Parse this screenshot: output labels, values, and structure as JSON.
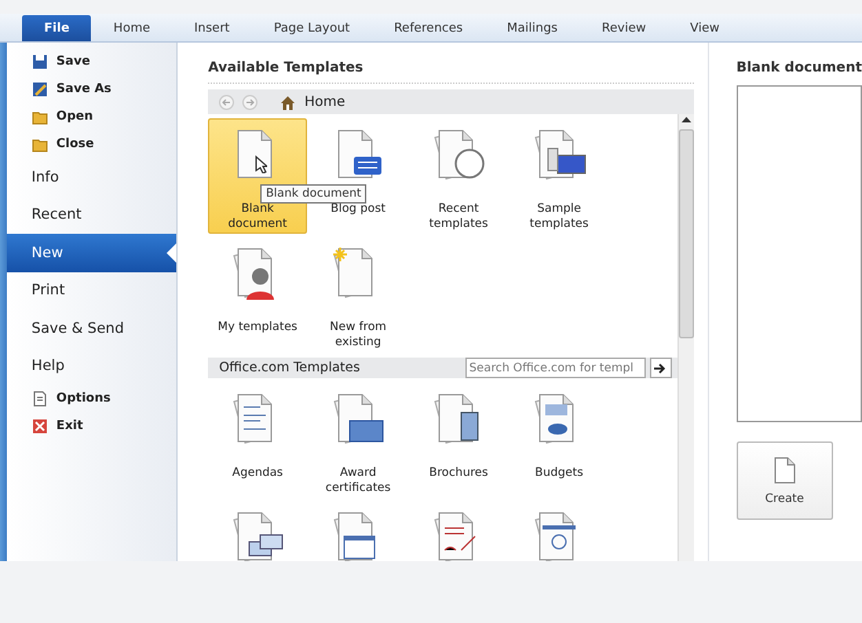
{
  "ribbon_tabs": [
    {
      "label": "File",
      "selected": true
    },
    {
      "label": "Home",
      "selected": false
    },
    {
      "label": "Insert",
      "selected": false
    },
    {
      "label": "Page Layout",
      "selected": false
    },
    {
      "label": "References",
      "selected": false
    },
    {
      "label": "Mailings",
      "selected": false
    },
    {
      "label": "Review",
      "selected": false
    },
    {
      "label": "View",
      "selected": false
    }
  ],
  "sidebar": {
    "items": [
      {
        "label": "Save",
        "kind": "small",
        "selected": false
      },
      {
        "label": "Save As",
        "kind": "small",
        "selected": false
      },
      {
        "label": "Open",
        "kind": "small",
        "selected": false
      },
      {
        "label": "Close",
        "kind": "small",
        "selected": false
      },
      {
        "label": "Info",
        "kind": "large",
        "selected": false
      },
      {
        "label": "Recent",
        "kind": "large",
        "selected": false
      },
      {
        "label": "New",
        "kind": "large",
        "selected": true
      },
      {
        "label": "Print",
        "kind": "large",
        "selected": false
      },
      {
        "label": "Save & Send",
        "kind": "large",
        "selected": false
      },
      {
        "label": "Help",
        "kind": "large",
        "selected": false
      },
      {
        "label": "Options",
        "kind": "small",
        "selected": false
      },
      {
        "label": "Exit",
        "kind": "small",
        "selected": false
      }
    ]
  },
  "available_templates": {
    "title": "Available Templates",
    "breadcrumb": "Home",
    "tooltip": "Blank document",
    "items": [
      {
        "label": "Blank document",
        "kind": "blank",
        "selected": true
      },
      {
        "label": "Blog post",
        "kind": "blog",
        "selected": false
      },
      {
        "label": "Recent templates",
        "kind": "clock",
        "selected": false
      },
      {
        "label": "Sample templates",
        "kind": "computer",
        "selected": false
      },
      {
        "label": "My templates",
        "kind": "person",
        "selected": false
      },
      {
        "label": "New from existing",
        "kind": "star",
        "selected": false
      }
    ]
  },
  "office_templates": {
    "title": "Office.com Templates",
    "search_placeholder": "Search Office.com for templ",
    "items": [
      {
        "label": "Agendas",
        "kind": "agenda"
      },
      {
        "label": "Award certificates",
        "kind": "award"
      },
      {
        "label": "Brochures",
        "kind": "brochure"
      },
      {
        "label": "Budgets",
        "kind": "budget"
      },
      {
        "kind": "cards"
      },
      {
        "kind": "calendar"
      },
      {
        "kind": "contract"
      },
      {
        "kind": "chart"
      }
    ]
  },
  "preview": {
    "title": "Blank document",
    "button": "Create"
  }
}
